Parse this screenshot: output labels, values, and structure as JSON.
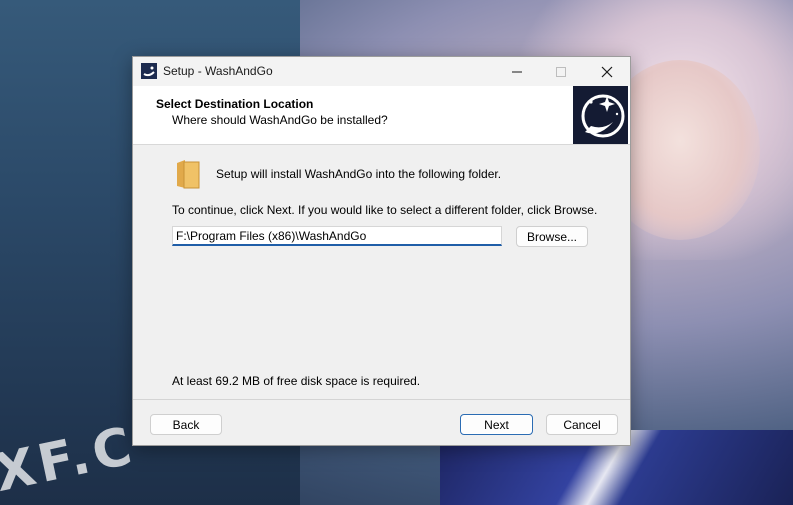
{
  "window": {
    "title": "Setup - WashAndGo",
    "controls": {
      "minimize": "—",
      "maximize": "☐",
      "close": "✕"
    }
  },
  "header": {
    "title": "Select Destination Location",
    "subtitle": "Where should WashAndGo be installed?"
  },
  "content": {
    "intro": "Setup will install WashAndGo into the following folder.",
    "instructions": "To continue, click Next. If you would like to select a different folder, click Browse.",
    "path_value": "F:\\Program Files (x86)\\WashAndGo",
    "browse_label": "Browse...",
    "disk_space": "At least 69.2 MB of free disk space is required."
  },
  "buttons": {
    "back": "Back",
    "next": "Next",
    "cancel": "Cancel"
  },
  "wallpaper": {
    "watermark": "XF.C"
  },
  "colors": {
    "accent": "#1f5ea8",
    "folder": "#f0c267"
  }
}
